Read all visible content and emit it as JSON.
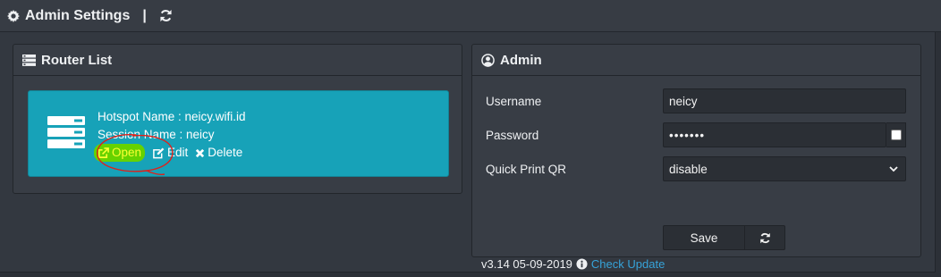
{
  "topbar": {
    "title": "Admin Settings",
    "separator": "|"
  },
  "router_list": {
    "header": "Router List",
    "router": {
      "hotspot_name": "Hotspot Name : neicy.wifi.id",
      "session_name": "Session Name : neicy",
      "actions": {
        "open": "Open",
        "edit": "Edit",
        "delete": "Delete"
      }
    }
  },
  "admin": {
    "header": "Admin",
    "username": {
      "label": "Username",
      "value": "neicy"
    },
    "password": {
      "label": "Password",
      "value": "•••••••"
    },
    "quick_print": {
      "label": "Quick Print QR",
      "value": "disable"
    },
    "save_label": "Save",
    "version": "v3.14 05-09-2019",
    "check_update": "Check Update"
  },
  "colors": {
    "tile": "#17a2b8",
    "highlight": "#66d200",
    "annotation": "#e0201a",
    "link": "#36a3d9"
  },
  "icons": [
    "gear-icon",
    "refresh-icon",
    "list-icon",
    "user-circle-icon",
    "server-icon",
    "external-link-icon",
    "edit-icon",
    "close-icon",
    "info-icon"
  ]
}
